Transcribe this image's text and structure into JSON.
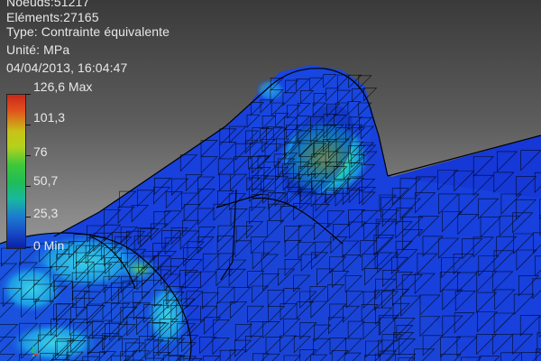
{
  "info": {
    "nodes": "Noeuds:51217",
    "elements": "Eléments:27165",
    "type": "Type: Contrainte équivalente",
    "unit": "Unité: MPa",
    "timestamp": "04/04/2013, 16:04:47"
  },
  "legend": {
    "labels": [
      "126,6 Max",
      "101,3",
      "76",
      "50,7",
      "25,3",
      "0 Min"
    ],
    "colors": [
      "#c8281a",
      "#c8c218",
      "#3cc83c",
      "#18b8a0",
      "#1646c4",
      "#0a1fa8"
    ]
  },
  "colors": {
    "mesh_base": "#1438d8",
    "stress_low": "#2a9ee8",
    "stress_mid": "#1ed0d8",
    "stress_high": "#b4e23c",
    "mesh_lines": "#000000"
  },
  "icons": [
    "axis-triad-icon"
  ]
}
